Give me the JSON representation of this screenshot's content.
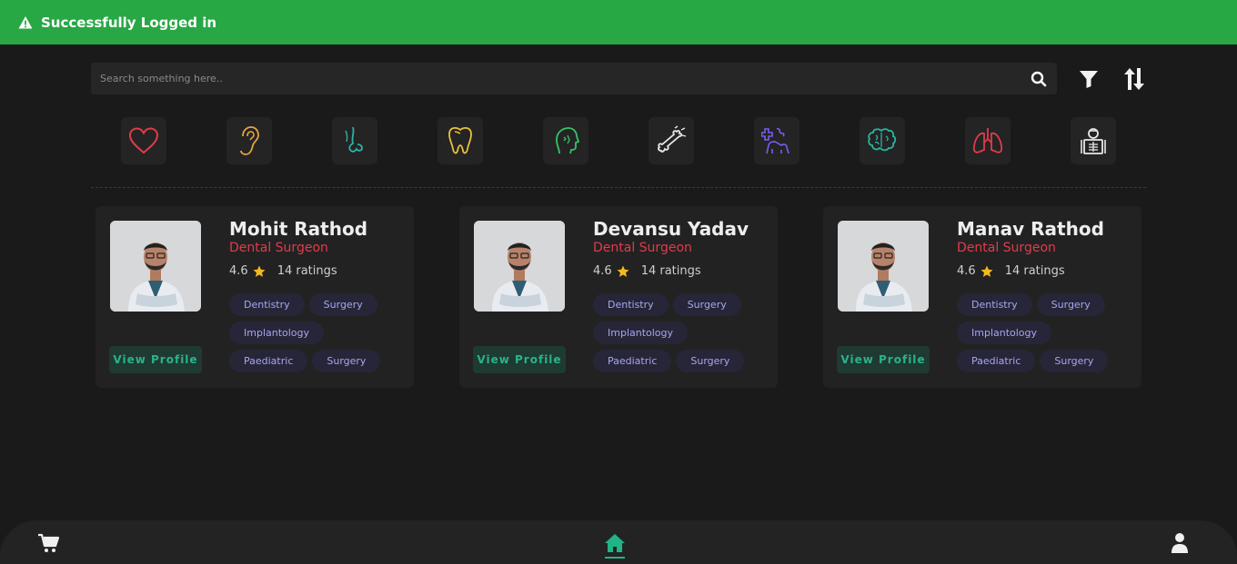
{
  "toast": {
    "message": "Successfully Logged in",
    "icon": "warning-icon",
    "color": "#28a745"
  },
  "search": {
    "placeholder": "Search something here..",
    "value": ""
  },
  "toolbar": {
    "filter_icon": "filter-icon",
    "sort_icon": "sort-icon"
  },
  "categories": [
    {
      "icon": "heart-icon",
      "color": "#e23b4a"
    },
    {
      "icon": "ear-icon",
      "color": "#e8a33d"
    },
    {
      "icon": "nose-icon",
      "color": "#2bb3a3"
    },
    {
      "icon": "tooth-icon",
      "color": "#e8c23d"
    },
    {
      "icon": "head-profile-icon",
      "color": "#35c46a"
    },
    {
      "icon": "bone-icon",
      "color": "#e8e8e8"
    },
    {
      "icon": "veterinary-icon",
      "color": "#7b5cf0"
    },
    {
      "icon": "brain-icon",
      "color": "#2bb3a3"
    },
    {
      "icon": "lungs-icon",
      "color": "#e23b4a"
    },
    {
      "icon": "radiology-icon",
      "color": "#e8e8e8"
    }
  ],
  "doctors": [
    {
      "name": "Mohit Rathod",
      "specialty": "Dental Surgeon",
      "rating": "4.6",
      "ratings_count": "14 ratings",
      "tags": [
        "Dentistry",
        "Surgery",
        "Implantology",
        "Paediatric",
        "Surgery"
      ],
      "button": "View Profile"
    },
    {
      "name": "Devansu Yadav",
      "specialty": "Dental Surgeon",
      "rating": "4.6",
      "ratings_count": "14 ratings",
      "tags": [
        "Dentistry",
        "Surgery",
        "Implantology",
        "Paediatric",
        "Surgery"
      ],
      "button": "View Profile"
    },
    {
      "name": "Manav Rathod",
      "specialty": "Dental Surgeon",
      "rating": "4.6",
      "ratings_count": "14 ratings",
      "tags": [
        "Dentistry",
        "Surgery",
        "Implantology",
        "Paediatric",
        "Surgery"
      ],
      "button": "View Profile"
    }
  ],
  "colors": {
    "accent": "#20b486",
    "specialty": "#e23b4a",
    "star": "#f5b91f",
    "tag_text": "#a8a6f0"
  },
  "bottom_nav": {
    "cart_icon": "cart-icon",
    "home_icon": "home-icon",
    "user_icon": "user-icon",
    "active": "home"
  }
}
